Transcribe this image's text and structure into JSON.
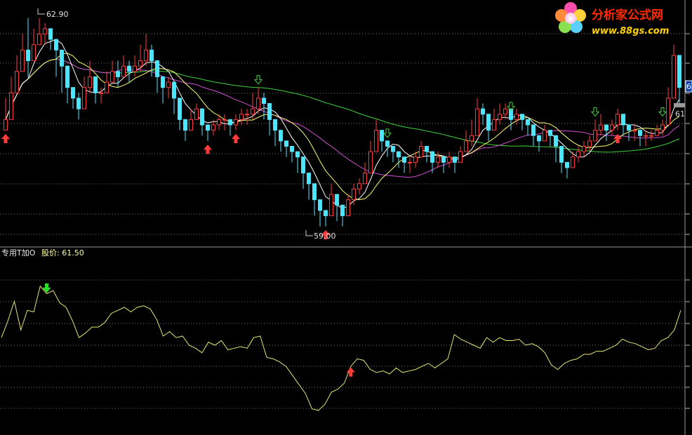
{
  "logo": {
    "title": "分析家公式网",
    "url": "www.88gs.com"
  },
  "colors": {
    "background": "#000000",
    "up": "#ff3b3b",
    "down": "#4ee6ff",
    "ma5": "#ffffff",
    "ma10": "#ffff70",
    "ma20": "#d04fd0",
    "ma60": "#3fd23f",
    "indicator": "#e6e676",
    "grid": "#7a7a7a",
    "axis": "#b4b4b4"
  },
  "price_panel": {
    "high_label": "62.90",
    "low_label": "59.00",
    "right_edge_label": "6",
    "right_value_label": "61"
  },
  "indicator_panel": {
    "name_text": "专用T加O",
    "price_label": "股价: 61.50"
  },
  "chart_data": [
    {
      "type": "candlestick",
      "ylim": [
        58.8,
        63.0
      ],
      "overlays": [
        "MA5",
        "MA10",
        "MA20",
        "MA60"
      ],
      "close": [
        61.0,
        61.5,
        61.9,
        62.3,
        62.1,
        62.4,
        62.6,
        62.7,
        62.5,
        62.3,
        62.0,
        61.6,
        61.4,
        61.2,
        61.6,
        61.8,
        61.5,
        61.5,
        61.7,
        61.9,
        61.8,
        62.0,
        61.9,
        62.0,
        62.1,
        62.3,
        62.1,
        61.8,
        61.6,
        61.7,
        61.4,
        61.0,
        60.8,
        61.0,
        61.2,
        60.9,
        60.8,
        60.9,
        61.0,
        61.0,
        60.9,
        61.0,
        61.1,
        61.1,
        61.2,
        61.4,
        61.3,
        61.0,
        60.8,
        60.6,
        60.5,
        60.4,
        60.3,
        60.0,
        59.8,
        59.5,
        59.3,
        59.2,
        59.6,
        59.4,
        59.2,
        59.5,
        59.7,
        59.8,
        60.0,
        60.4,
        60.8,
        60.6,
        60.5,
        60.4,
        60.3,
        60.2,
        60.2,
        60.3,
        60.5,
        60.4,
        60.2,
        60.3,
        60.2,
        60.3,
        60.2,
        60.4,
        60.6,
        60.7,
        61.2,
        61.1,
        60.8,
        61.0,
        61.1,
        61.2,
        61.0,
        61.1,
        61.0,
        60.9,
        60.7,
        60.6,
        60.8,
        60.7,
        60.5,
        60.2,
        60.1,
        60.3,
        60.4,
        60.5,
        60.6,
        60.8,
        60.9,
        60.8,
        60.9,
        61.1,
        60.9,
        60.8,
        60.8,
        60.7,
        60.7,
        60.7,
        60.8,
        60.9,
        61.4,
        62.2,
        61.6
      ],
      "high": [
        61.4,
        61.8,
        62.2,
        62.6,
        62.9,
        62.7,
        62.9,
        62.8,
        62.7,
        62.5,
        62.3,
        61.9,
        61.6,
        61.5,
        61.8,
        62.1,
        61.8,
        61.6,
        61.9,
        62.1,
        62.1,
        62.2,
        62.1,
        62.2,
        62.4,
        62.6,
        62.4,
        62.0,
        61.8,
        61.8,
        61.6,
        61.2,
        61.0,
        61.2,
        61.3,
        61.0,
        60.9,
        61.0,
        61.1,
        61.1,
        61.0,
        61.1,
        61.2,
        61.2,
        61.5,
        61.6,
        61.5,
        61.1,
        60.9,
        60.7,
        60.6,
        60.5,
        60.4,
        60.1,
        59.9,
        59.6,
        59.4,
        59.3,
        59.8,
        59.5,
        59.3,
        59.6,
        59.8,
        59.9,
        60.2,
        60.6,
        61.0,
        60.7,
        60.6,
        60.5,
        60.4,
        60.3,
        60.3,
        60.4,
        60.6,
        60.5,
        60.3,
        60.4,
        60.3,
        60.4,
        60.3,
        60.5,
        60.8,
        61.0,
        61.4,
        61.3,
        61.0,
        61.2,
        61.3,
        61.3,
        61.1,
        61.2,
        61.1,
        61.0,
        60.8,
        60.7,
        60.9,
        60.8,
        60.6,
        60.3,
        60.2,
        60.4,
        60.5,
        60.6,
        60.7,
        61.0,
        61.1,
        60.9,
        61.0,
        61.2,
        61.0,
        60.9,
        60.9,
        60.8,
        60.8,
        60.8,
        60.9,
        61.0,
        61.6,
        62.4,
        62.1
      ],
      "low": [
        60.8,
        61.1,
        61.6,
        62.0,
        61.8,
        62.2,
        62.4,
        62.4,
        62.3,
        61.8,
        61.5,
        61.3,
        61.2,
        61.0,
        61.3,
        61.5,
        61.3,
        61.3,
        61.5,
        61.7,
        61.6,
        61.8,
        61.7,
        61.8,
        61.9,
        62.0,
        61.8,
        61.5,
        61.3,
        61.4,
        61.1,
        60.8,
        60.6,
        60.8,
        61.0,
        60.7,
        60.6,
        60.7,
        60.8,
        60.8,
        60.7,
        60.8,
        60.9,
        60.9,
        61.0,
        61.1,
        61.0,
        60.7,
        60.5,
        60.4,
        60.3,
        60.2,
        60.0,
        59.7,
        59.5,
        59.2,
        59.0,
        59.0,
        59.3,
        59.1,
        59.0,
        59.2,
        59.4,
        59.6,
        59.8,
        60.1,
        60.4,
        60.4,
        60.3,
        60.2,
        60.1,
        60.0,
        60.0,
        60.1,
        60.3,
        60.2,
        60.0,
        60.1,
        60.0,
        60.1,
        60.0,
        60.2,
        60.4,
        60.5,
        60.9,
        60.9,
        60.6,
        60.8,
        60.9,
        61.0,
        60.8,
        60.9,
        60.8,
        60.7,
        60.5,
        60.4,
        60.6,
        60.5,
        60.2,
        60.0,
        59.9,
        60.1,
        60.2,
        60.3,
        60.4,
        60.6,
        60.7,
        60.6,
        60.7,
        60.8,
        60.7,
        60.6,
        60.6,
        60.5,
        60.5,
        60.6,
        60.7,
        60.7,
        61.1,
        61.5,
        61.3
      ],
      "buy_signal_bars": [
        0,
        36,
        41,
        57,
        109
      ],
      "sell_signal_bars": [
        45,
        68,
        90,
        105,
        117
      ]
    },
    {
      "type": "line",
      "ylim": [
        0,
        100
      ],
      "values": [
        55,
        66,
        79,
        60,
        73,
        72,
        89,
        84,
        86,
        78,
        75,
        66,
        55,
        58,
        62,
        62,
        65,
        71,
        73,
        75,
        72,
        75,
        76,
        74,
        67,
        56,
        59,
        55,
        56,
        50,
        48,
        45,
        52,
        50,
        53,
        47,
        48,
        49,
        48,
        55,
        56,
        42,
        41,
        39,
        36,
        30,
        24,
        18,
        8,
        7,
        11,
        19,
        21,
        25,
        36,
        41,
        40,
        34,
        32,
        33,
        31,
        35,
        32,
        33,
        34,
        36,
        38,
        35,
        38,
        41,
        57,
        54,
        52,
        50,
        48,
        55,
        52,
        55,
        53,
        53,
        54,
        50,
        51,
        49,
        45,
        37,
        34,
        38,
        40,
        41,
        44,
        44,
        46,
        46,
        48,
        50,
        54,
        52,
        51,
        49,
        47,
        48,
        53,
        55,
        60,
        73
      ],
      "buy_signal_index": 54,
      "sell_signal_index": 7
    }
  ]
}
